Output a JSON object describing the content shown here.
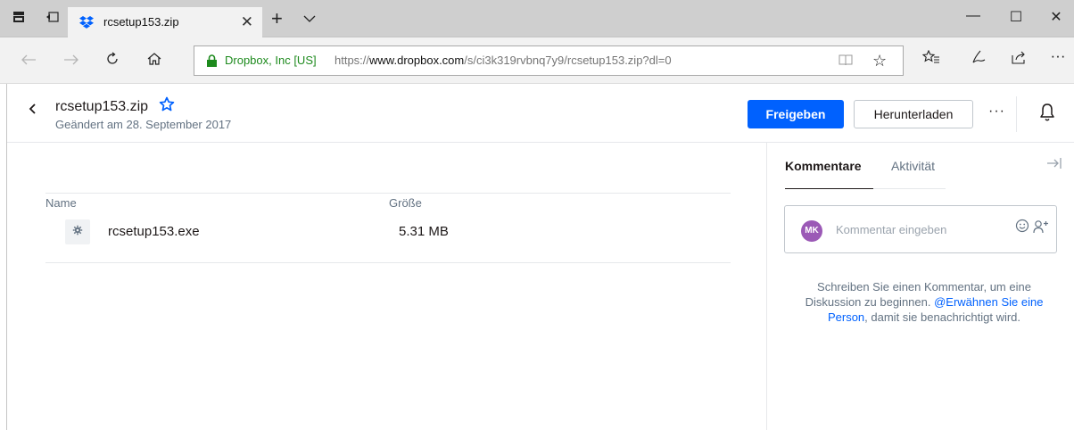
{
  "browser": {
    "tab": {
      "title": "rcsetup153.zip",
      "close": "✕"
    },
    "new_tab": "+",
    "tab_menu": "⌵",
    "window": {
      "minimize": "—",
      "maximize": "☐",
      "close": "✕"
    },
    "address": {
      "org": "Dropbox, Inc [US]",
      "url_prefix": "https://",
      "url_host": "www.dropbox.com",
      "url_path": "/s/ci3k319rvbnq7y9/rcsetup153.zip?dl=0"
    },
    "toolbar_icons": [
      "favorites-icon",
      "notes-icon",
      "share-icon",
      "more-icon"
    ]
  },
  "header": {
    "file_name": "rcsetup153.zip",
    "modified": "Geändert am 28. September 2017",
    "share_label": "Freigeben",
    "download_label": "Herunterladen",
    "more_label": "···"
  },
  "filelist": {
    "columns": [
      "Name",
      "Größe"
    ],
    "rows": [
      {
        "name": "rcsetup153.exe",
        "size": "5.31 MB",
        "icon": "gear-icon"
      }
    ]
  },
  "sidebar": {
    "tabs": [
      {
        "label": "Kommentare",
        "active": true
      },
      {
        "label": "Aktivität",
        "active": false
      }
    ],
    "avatar_initials": "MK",
    "comment_placeholder": "Kommentar eingeben",
    "empty_text_1": "Schreiben Sie einen Kommentar, um eine Diskussion zu beginnen. ",
    "empty_link": "@Erwähnen Sie eine Person",
    "empty_text_2": ", damit sie benachrichtigt wird."
  },
  "colors": {
    "accent": "#0061fe",
    "avatar": "#9b59b6",
    "secure_green": "#1d8a1d"
  }
}
